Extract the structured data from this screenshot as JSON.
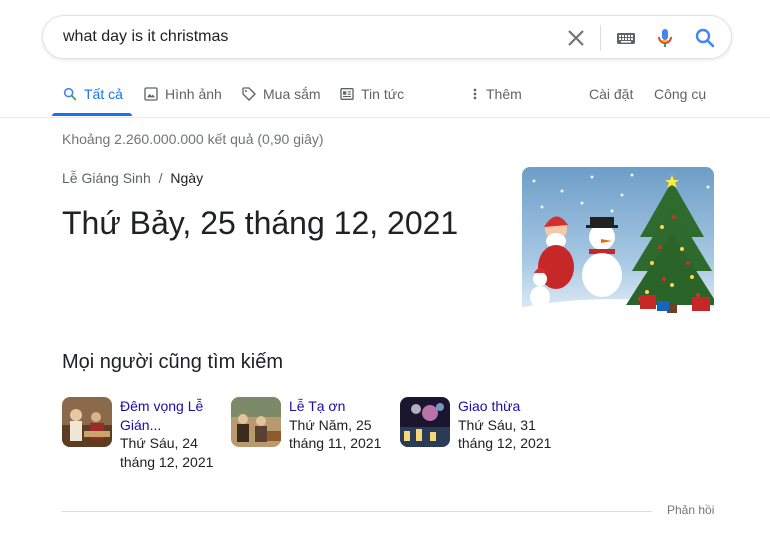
{
  "search": {
    "query": "what day is it christmas"
  },
  "tabs": [
    {
      "label": "Tất cả",
      "icon": "search-icon"
    },
    {
      "label": "Hình ảnh",
      "icon": "image-icon"
    },
    {
      "label": "Mua sắm",
      "icon": "tag-icon"
    },
    {
      "label": "Tin tức",
      "icon": "news-icon"
    },
    {
      "label": "Thêm",
      "icon": "more-vert-icon"
    }
  ],
  "tools": {
    "settings": "Cài đặt",
    "tools": "Công cụ"
  },
  "stats": "Khoảng 2.260.000.000 kết quả (0,90 giây)",
  "answer": {
    "breadcrumb_parent": "Lễ Giáng Sinh",
    "breadcrumb_sep": "/",
    "breadcrumb_child": "Ngày",
    "value": "Thứ Bảy, 25 tháng 12, 2021"
  },
  "people_also_search": {
    "title": "Mọi người cũng tìm kiếm",
    "items": [
      {
        "title": "Đêm vọng Lễ Gián...",
        "sub": "Thứ Sáu, 24 tháng 12, 2021"
      },
      {
        "title": "Lễ Tạ ơn",
        "sub": "Thứ Năm, 25 tháng 11, 2021"
      },
      {
        "title": "Giao thừa",
        "sub": "Thứ Sáu, 31 tháng 12, 2021"
      }
    ]
  },
  "feedback": "Phản hồi",
  "colors": {
    "accent": "#1a73e8",
    "link": "#1a0dab",
    "muted": "#70757a"
  }
}
